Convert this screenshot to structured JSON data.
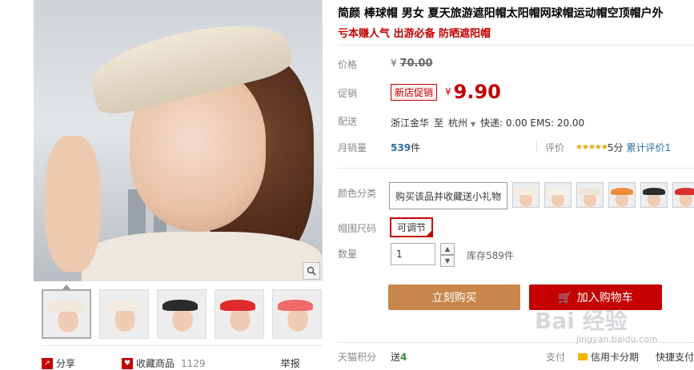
{
  "product": {
    "title": "简颜 棒球帽 男女 夏天旅游遮阳帽太阳帽网球帽运动帽空顶帽户外",
    "subtitle": "亏本赚人气 出游必备 防晒遮阳帽"
  },
  "pricing": {
    "price_label": "价格",
    "original_currency": "¥",
    "original_price": "70.00",
    "promo_label": "促销",
    "promo_badge": "新店促销",
    "promo_currency": "¥",
    "promo_price": "9.90"
  },
  "delivery": {
    "label": "配送",
    "from": "浙江金华",
    "to_word": "至",
    "to": "杭州",
    "shipping": "快递: 0.00 EMS: 20.00"
  },
  "sales": {
    "label": "月销量",
    "count": "539",
    "unit": "件",
    "rating_label": "评价",
    "stars": "★★★★★",
    "score": "5分",
    "review_link": "累计评价1"
  },
  "sku": {
    "color_label": "颜色分类",
    "color_text_option": "购买该品并收藏送小礼物",
    "color_swatches": [
      "#f2ece1",
      "#f5f0e8",
      "#ece6da",
      "#ef8a3a",
      "#2c2c2c",
      "#d9312e"
    ],
    "size_label": "帽围尺码",
    "size_option": "可调节",
    "qty_label": "数量",
    "qty_value": "1",
    "stock": "库存589件"
  },
  "actions": {
    "buy_now": "立刻购买",
    "add_to_cart": "加入购物车"
  },
  "footer": {
    "points_label": "天猫积分",
    "points_prefix": "送",
    "points_value": "4",
    "pay_label": "支付",
    "pay_card": "信用卡分期",
    "pay_quick": "快捷支付"
  },
  "gallery": {
    "thumb_hat_colors": [
      "#efe7d8",
      "#f3ece0",
      "#2b2b2b",
      "#e02a2a",
      "#f06a6a"
    ],
    "share_label": "分享",
    "fav_label": "收藏商品",
    "fav_count": "1129",
    "report_label": "举报"
  },
  "watermark": {
    "brand": "Bai 经验",
    "url": "jingyan.baidu.com"
  }
}
